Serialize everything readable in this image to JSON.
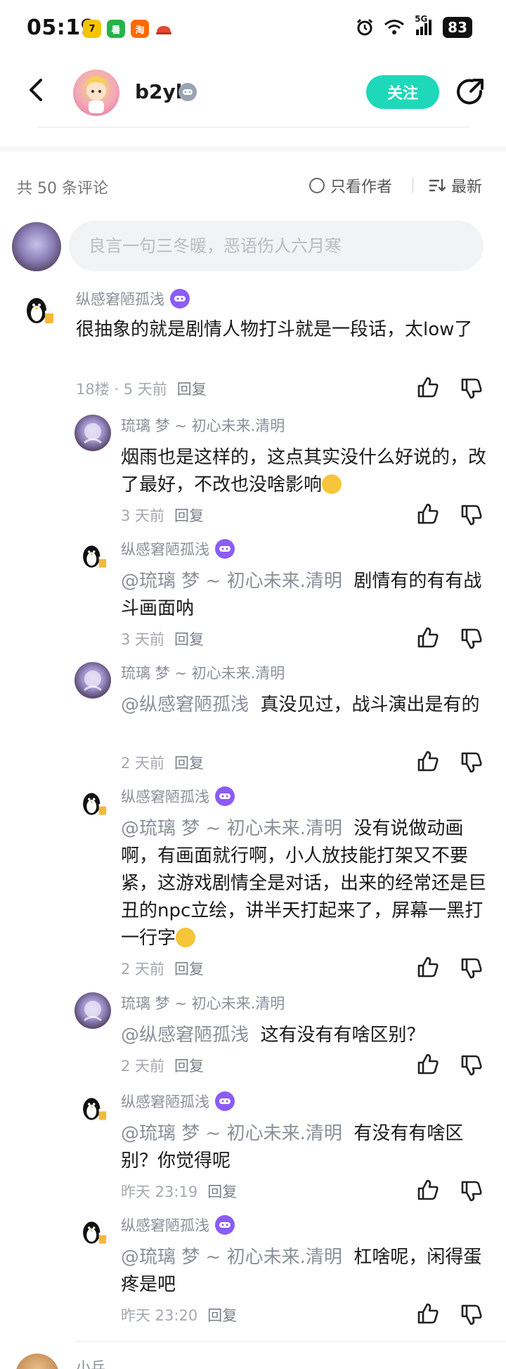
{
  "status_bar": {
    "time": "05:19",
    "apps": [
      "七猫",
      "暑假",
      "淘宝",
      "饿了么"
    ],
    "network": "5G",
    "battery": "83"
  },
  "header": {
    "username": "b2yl",
    "follow_label": "关注"
  },
  "comments_header": {
    "count_label": "共 50 条评论",
    "only_author_label": "只看作者",
    "sort_label": "最新"
  },
  "input": {
    "placeholder": "良言一句三冬暖，恶语伤人六月寒"
  },
  "main_comment": {
    "author": "纵感窘陋孤浅",
    "text": "很抽象的就是剧情人物打斗就是一段话，太low了",
    "meta": "18楼 · 5 天前",
    "reply_label": "回复"
  },
  "replies": [
    {
      "author": "琉璃 梦 ~ 初心未来.清明",
      "badge": false,
      "mention": "",
      "text": "烟雨也是这样的，这点其实没什么好说的，改了最好，不改也没啥影响",
      "emoji": "crying",
      "time": "3 天前",
      "reply_label": "回复"
    },
    {
      "author": "纵感窘陋孤浅",
      "badge": true,
      "mention": "@琉璃 梦 ~ 初心未来.清明",
      "text": "剧情有的有有战斗画面呐",
      "emoji": "",
      "time": "3 天前",
      "reply_label": "回复"
    },
    {
      "author": "琉璃 梦 ~ 初心未来.清明",
      "badge": false,
      "mention": "@纵感窘陋孤浅",
      "text": "真没见过，战斗演出是有的",
      "emoji": "",
      "time": "2 天前",
      "reply_label": "回复"
    },
    {
      "author": "纵感窘陋孤浅",
      "badge": true,
      "mention": "@琉璃 梦 ~ 初心未来.清明",
      "text": "没有说做动画啊，有画面就行啊，小人放技能打架又不要紧，这游戏剧情全是对话，出来的经常还是巨丑的npc立绘，讲半天打起来了，屏幕一黑打一行字",
      "emoji": "cool",
      "time": "2 天前",
      "reply_label": "回复"
    },
    {
      "author": "琉璃 梦 ~ 初心未来.清明",
      "badge": false,
      "mention": "@纵感窘陋孤浅",
      "text": "这有没有有啥区别？",
      "emoji": "",
      "time": "2 天前",
      "reply_label": "回复"
    },
    {
      "author": "纵感窘陋孤浅",
      "badge": true,
      "mention": "@琉璃 梦 ~ 初心未来.清明",
      "text": "有没有有啥区别？你觉得呢",
      "emoji": "",
      "time": "昨天 23:19",
      "reply_label": "回复"
    },
    {
      "author": "纵感窘陋孤浅",
      "badge": true,
      "mention": "@琉璃 梦 ~ 初心未来.清明",
      "text": "杠啥呢，闲得蛋疼是吧",
      "emoji": "",
      "time": "昨天 23:20",
      "reply_label": "回复"
    }
  ],
  "next_comment": {
    "author": "小兵"
  },
  "colors": {
    "accent": "#1ed8b9",
    "badge_purple": "#8b5cf6",
    "muted": "#8a8f99"
  }
}
